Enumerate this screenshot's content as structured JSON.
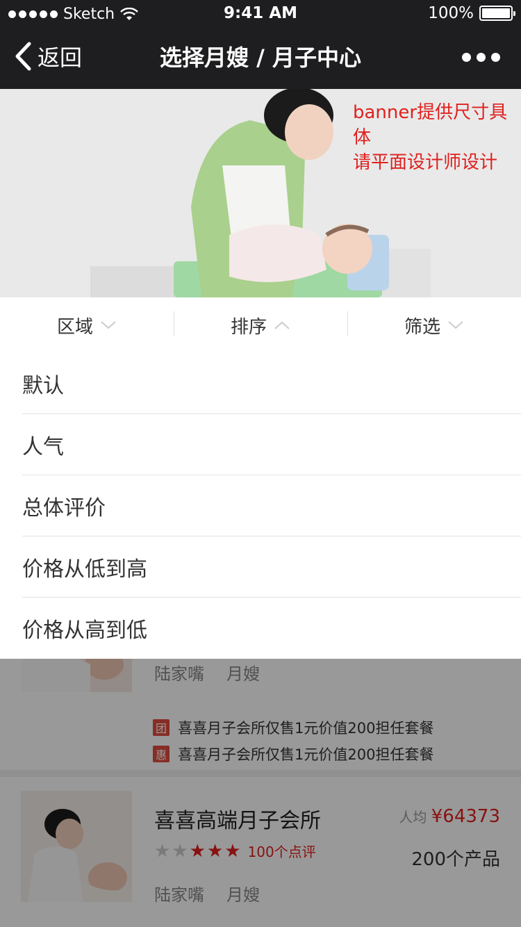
{
  "status": {
    "carrier": "Sketch",
    "time": "9:41 AM",
    "battery": "100%"
  },
  "nav": {
    "back_label": "返回",
    "title": "选择月嫂 / 月子中心"
  },
  "banner": {
    "note_line1": "banner提供尺寸具体",
    "note_line2": "请平面设计师设计"
  },
  "filters": [
    {
      "label": "区域",
      "state": "collapsed"
    },
    {
      "label": "排序",
      "state": "expanded"
    },
    {
      "label": "筛选",
      "state": "collapsed"
    }
  ],
  "sort_options": [
    "默认",
    "人气",
    "总体评价",
    "价格从低到高",
    "价格从高到低"
  ],
  "list": {
    "item1": {
      "location": "陆家嘴",
      "type": "月嫂",
      "promos": [
        {
          "tag": "团",
          "text": "喜喜月子会所仅售1元价值200担任套餐"
        },
        {
          "tag": "惠",
          "text": "喜喜月子会所仅售1元价值200担任套餐"
        }
      ]
    },
    "item2": {
      "name": "喜喜高端月子会所",
      "rating": 3,
      "rating_max": 5,
      "reviews": "100个点评",
      "avg_label": "人均",
      "avg_price": "¥64373",
      "products": "200个产品",
      "location": "陆家嘴",
      "type": "月嫂"
    }
  },
  "colors": {
    "nav_bg": "#1e1e20",
    "accent_red": "#e0201e",
    "tag_red": "#e04b3e",
    "overlay": "rgba(0,0,0,0.4)"
  }
}
